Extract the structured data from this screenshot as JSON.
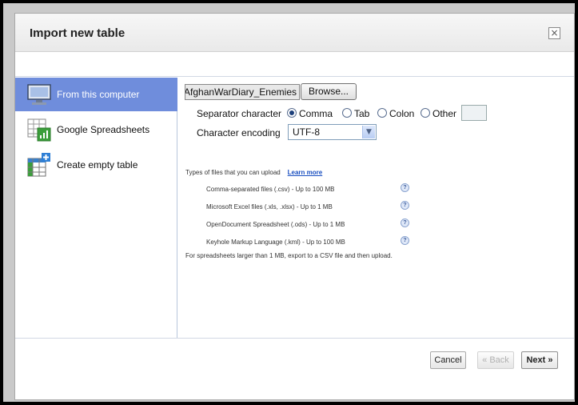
{
  "dialog": {
    "title": "Import new table",
    "close_label": "×"
  },
  "sidebar": {
    "items": [
      {
        "label": "From this computer",
        "icon": "computer-icon",
        "active": true
      },
      {
        "label": "Google Spreadsheets",
        "icon": "spreadsheet-icon",
        "active": false
      },
      {
        "label": "Create empty table",
        "icon": "empty-table-icon",
        "active": false
      }
    ]
  },
  "upload": {
    "file_name": "AfghanWarDiary_Enemies",
    "browse_label": "Browse...",
    "separator_label": "Separator character",
    "separator_options": [
      "Comma",
      "Tab",
      "Colon",
      "Other"
    ],
    "separator_selected": "Comma",
    "encoding_label": "Character encoding",
    "encoding_value": "UTF-8"
  },
  "info": {
    "types_text": "Types of files that you can upload",
    "learn_more": "Learn more",
    "file_types": [
      "Comma-separated files (.csv) - Up to 100 MB",
      "Microsoft Excel files (.xls, .xlsx) - Up to 1 MB",
      "OpenDocument Spreadsheet (.ods) - Up to 1 MB",
      "Keyhole Markup Language (.kml) - Up to 100 MB"
    ],
    "help_glyph": "?",
    "note": "For spreadsheets larger than 1 MB, export to a CSV file and then upload."
  },
  "footer": {
    "cancel_label": "Cancel",
    "back_label": "« Back",
    "next_label": "Next »"
  },
  "colors": {
    "active_item": "#6f8ddc",
    "link": "#1a4fc0"
  }
}
